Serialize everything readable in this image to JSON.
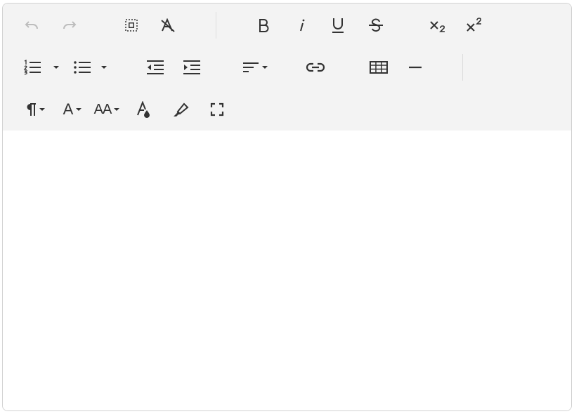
{
  "toolbar": {
    "font_label": "A",
    "font_size_label": "AA"
  },
  "editor": {
    "content_text": ""
  }
}
